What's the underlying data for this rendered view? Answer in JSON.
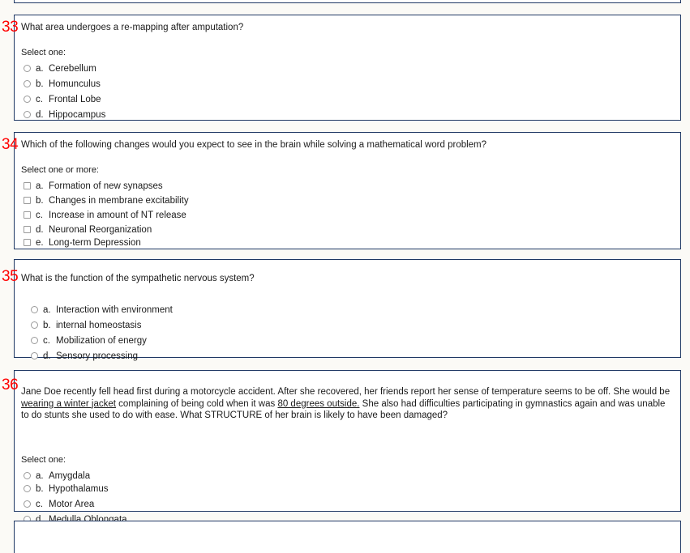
{
  "page": {
    "background_color": "#fbfaf6",
    "box_border_color": "#1f3864",
    "question_number_color": "#ff0000",
    "control_color": "#9a9a9a"
  },
  "questions": [
    {
      "number": "33",
      "text": "What area undergoes a re-mapping after amputation?",
      "select_label": "Select one:",
      "control_type": "radio",
      "options": [
        {
          "letter": "a.",
          "text": "Cerebellum"
        },
        {
          "letter": "b.",
          "text": "Homunculus"
        },
        {
          "letter": "c.",
          "text": "Frontal Lobe"
        },
        {
          "letter": "d.",
          "text": "Hippocampus"
        }
      ]
    },
    {
      "number": "34",
      "text": "Which of the following changes would you expect to see in the brain while solving a mathematical word problem?",
      "select_label": "Select one or more:",
      "control_type": "checkbox",
      "options": [
        {
          "letter": "a.",
          "text": "Formation of new synapses"
        },
        {
          "letter": "b.",
          "text": "Changes in membrane excitability"
        },
        {
          "letter": "c.",
          "text": "Increase in amount of NT release"
        },
        {
          "letter": "d.",
          "text": "Neuronal Reorganization"
        },
        {
          "letter": "e.",
          "text": "Long-term Depression"
        }
      ]
    },
    {
      "number": "35",
      "text": "What is the function of the sympathetic nervous system?",
      "select_label": "",
      "control_type": "radio",
      "options": [
        {
          "letter": "a.",
          "text": "Interaction with environment"
        },
        {
          "letter": "b.",
          "text": "internal homeostasis"
        },
        {
          "letter": "c.",
          "text": "Mobilization of energy"
        },
        {
          "letter": "d.",
          "text": "Sensory processing"
        }
      ]
    },
    {
      "number": "36",
      "text_segments": [
        {
          "text": "Jane Doe recently fell head first during a motorcycle accident. After she recovered, her friends report her sense of temperature seems to be off. She would be ",
          "underline": false
        },
        {
          "text": "wearing a winter jacket",
          "underline": true
        },
        {
          "text": " complaining of being cold when it was ",
          "underline": false
        },
        {
          "text": "80 degrees outside.",
          "underline": true
        },
        {
          "text": " She also had difficulties participating in gymnastics again and was unable to do stunts she used to do with ease. What STRUCTURE of her brain is likely to have been damaged?",
          "underline": false
        }
      ],
      "select_label": "Select one:",
      "control_type": "radio",
      "options": [
        {
          "letter": "a.",
          "text": "Amygdala"
        },
        {
          "letter": "b.",
          "text": "Hypothalamus"
        },
        {
          "letter": "c.",
          "text": "Motor Area"
        },
        {
          "letter": "d.",
          "text": "Medulla Oblongata"
        }
      ]
    }
  ]
}
